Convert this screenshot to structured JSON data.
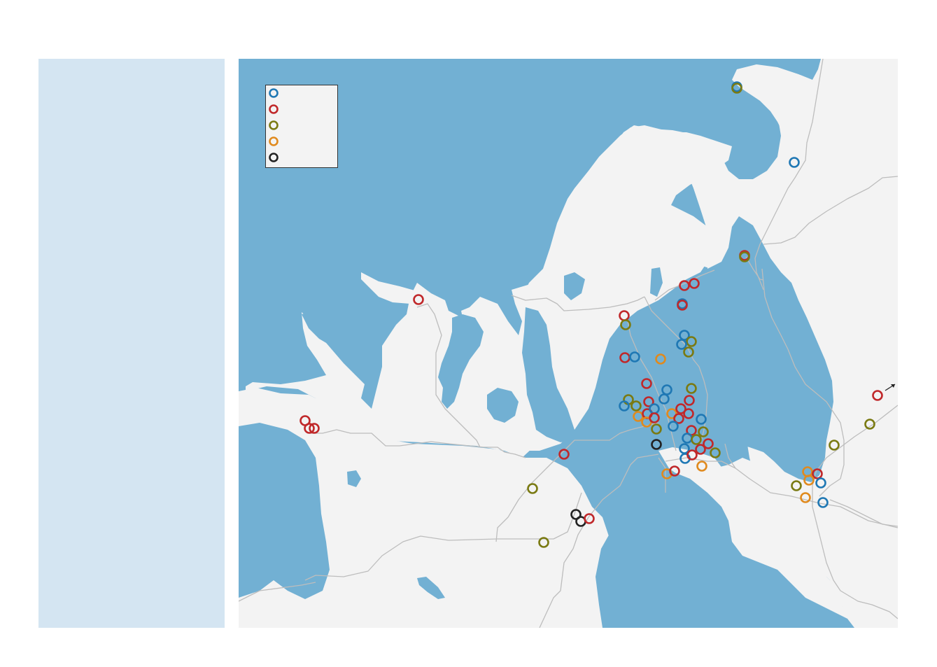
{
  "categories": [
    {
      "id": "blue",
      "color": "#1f78b4",
      "label": ""
    },
    {
      "id": "red",
      "color": "#c0282a",
      "label": ""
    },
    {
      "id": "olive",
      "color": "#7a7a12",
      "label": ""
    },
    {
      "id": "orange",
      "color": "#e08a1e",
      "label": ""
    },
    {
      "id": "black",
      "color": "#222222",
      "label": ""
    }
  ],
  "colors": {
    "water": "#72b0d3",
    "land": "#f3f3f3",
    "road": "#bdbdbd",
    "side_panel": "#d4e5f2"
  },
  "icons": {
    "offmap_arrow": "arrow-up-right-icon"
  }
}
